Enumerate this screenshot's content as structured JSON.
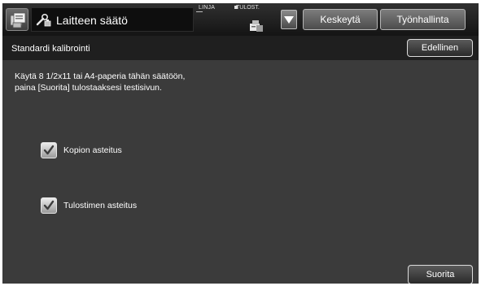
{
  "topbar": {
    "mode_title": "Laitteen säätö",
    "status_line": "LINJA",
    "status_print": "TULOST.",
    "pause_button": "Keskeytä",
    "job_status_button": "Työnhallinta",
    "icons": {
      "menu": "copier-menu-icon",
      "title": "adjustment-tools-icon",
      "printer": "printer-status-icon",
      "dropdown": "triangle-down-icon"
    }
  },
  "subheader": {
    "title": "Standardi kalibrointi",
    "back_button": "Edellinen"
  },
  "main": {
    "instruction_line1": "Käytä 8 1/2x11 tai A4-paperia tähän säätöön,",
    "instruction_line2": "paina [Suorita] tulostaaksesi testisivun.",
    "options": [
      {
        "label": "Kopion asteitus",
        "checked": true
      },
      {
        "label": "Tulostimen asteitus",
        "checked": true
      }
    ],
    "execute_button": "Suorita"
  },
  "colors": {
    "background": "#3b3b3b",
    "topbar": "#141414",
    "subheader": "#1f1f1f",
    "text": "#ffffff"
  }
}
